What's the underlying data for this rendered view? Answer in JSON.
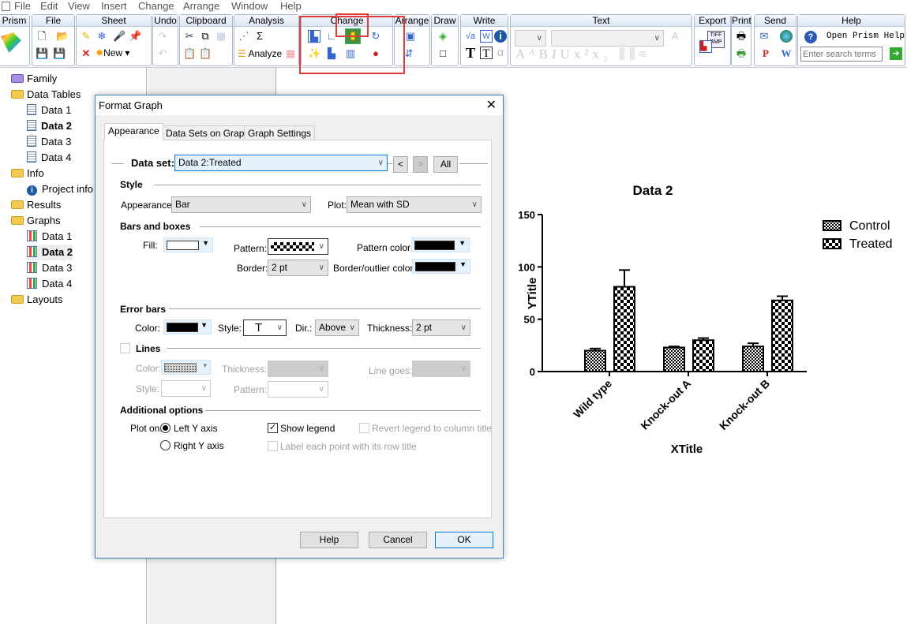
{
  "menu": [
    "File",
    "Edit",
    "View",
    "Insert",
    "Change",
    "Arrange",
    "Window",
    "Help"
  ],
  "toolbar": {
    "groups": [
      "Prism",
      "File",
      "Sheet",
      "Undo",
      "Clipboard",
      "Analysis",
      "Change",
      "Arrange",
      "Draw",
      "Write",
      "Text",
      "Export",
      "Print",
      "Send",
      "Help"
    ],
    "sheet_new": "New",
    "analysis_analyze": "Analyze",
    "help_open": "Open Prism Help",
    "search_placeholder": "Enter search terms",
    "export_badge": "TIFF BMP"
  },
  "tree": {
    "family": "Family",
    "data_tables": "Data Tables",
    "tables": [
      "Data 1",
      "Data 2",
      "Data 3",
      "Data 4"
    ],
    "info": "Info",
    "project_info": "Project info",
    "results": "Results",
    "graphs": "Graphs",
    "graph_items": [
      "Data 1",
      "Data 2",
      "Data 3",
      "Data 4"
    ],
    "layouts": "Layouts"
  },
  "dialog": {
    "title": "Format Graph",
    "tabs": [
      "Appearance",
      "Data Sets on Graph",
      "Graph Settings"
    ],
    "data_set_label": "Data set:",
    "data_set_value": "Data 2:Treated",
    "prev": "<",
    "next": ">",
    "all": "All",
    "style": {
      "heading": "Style",
      "appearance_label": "Appearance:",
      "appearance_value": "Bar",
      "plot_label": "Plot:",
      "plot_value": "Mean with SD"
    },
    "bars": {
      "heading": "Bars and boxes",
      "fill_label": "Fill:",
      "fill_color": "#ffffff",
      "pattern_label": "Pattern:",
      "pattern_color_label": "Pattern color:",
      "pattern_color": "#000000",
      "border_label": "Border:",
      "border_value": "2 pt",
      "border_color_label": "Border/outlier color:",
      "border_color": "#000000"
    },
    "error_bars": {
      "heading": "Error bars",
      "color_label": "Color:",
      "color": "#000000",
      "style_label": "Style:",
      "style_value": "T",
      "dir_label": "Dir.:",
      "dir_value": "Above",
      "thickness_label": "Thickness:",
      "thickness_value": "2 pt"
    },
    "lines": {
      "heading": "Lines",
      "checked": false,
      "color_label": "Color:",
      "thickness_label": "Thickness:",
      "line_goes_label": "Line goes:",
      "style_label": "Style:",
      "pattern_label": "Pattern:"
    },
    "additional": {
      "heading": "Additional options",
      "plot_on_label": "Plot on:",
      "left_y": "Left Y axis",
      "right_y": "Right  Y axis",
      "plot_on_selected": "Left Y axis",
      "show_legend": "Show legend",
      "show_legend_checked": true,
      "revert_legend": "Revert legend to column title",
      "label_points": "Label each point with its row title"
    },
    "buttons": {
      "help": "Help",
      "cancel": "Cancel",
      "ok": "OK"
    }
  },
  "chart_data": {
    "type": "bar",
    "title": "Data 2",
    "xlabel": "XTitle",
    "ylabel": "YTitle",
    "categories": [
      "Wild type",
      "Knock-out A",
      "Knock-out B"
    ],
    "ylim": [
      0,
      150
    ],
    "yticks": [
      0,
      50,
      100,
      150
    ],
    "series": [
      {
        "name": "Control",
        "values": [
          20,
          23,
          24
        ],
        "sd": [
          2,
          1,
          3
        ],
        "pattern": "fine-checker"
      },
      {
        "name": "Treated",
        "values": [
          81,
          30,
          68
        ],
        "sd": [
          16,
          2,
          4
        ],
        "pattern": "checker"
      }
    ],
    "legend": "top-right",
    "grid": false
  }
}
